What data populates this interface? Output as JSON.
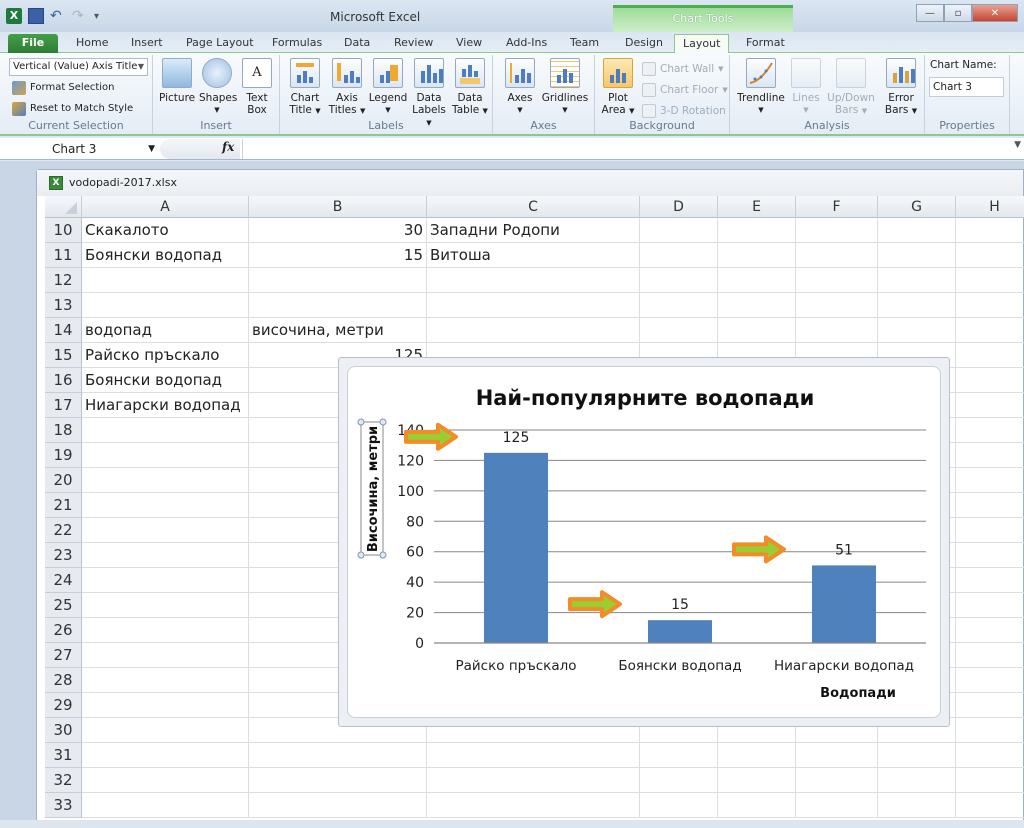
{
  "titlebar": {
    "app_title": "Microsoft Excel",
    "context_group": "Chart Tools",
    "qat": {
      "save": "save-icon",
      "undo": "undo-icon",
      "redo": "redo-icon"
    },
    "window_controls": {
      "minimize": "—",
      "maximize": "▫",
      "close": "✕"
    }
  },
  "tabs": [
    {
      "label": "File"
    },
    {
      "label": "Home"
    },
    {
      "label": "Insert"
    },
    {
      "label": "Page Layout"
    },
    {
      "label": "Formulas"
    },
    {
      "label": "Data"
    },
    {
      "label": "Review"
    },
    {
      "label": "View"
    },
    {
      "label": "Add-Ins"
    },
    {
      "label": "Team"
    },
    {
      "label": "Design"
    },
    {
      "label": "Layout",
      "active": true
    },
    {
      "label": "Format"
    }
  ],
  "ribbon": {
    "current_selection": {
      "dropdown_value": "Vertical (Value) Axis Title",
      "format_selection": "Format Selection",
      "reset": "Reset to Match Style",
      "group_label": "Current Selection"
    },
    "insert": {
      "picture": "Picture",
      "shapes": "Shapes",
      "text_box_1": "Text",
      "text_box_2": "Box",
      "group_label": "Insert"
    },
    "labels": {
      "chart_title_1": "Chart",
      "chart_title_2": "Title",
      "axis_titles_1": "Axis",
      "axis_titles_2": "Titles",
      "legend": "Legend",
      "data_labels_1": "Data",
      "data_labels_2": "Labels",
      "data_table_1": "Data",
      "data_table_2": "Table",
      "group_label": "Labels"
    },
    "axes": {
      "axes": "Axes",
      "gridlines": "Gridlines",
      "group_label": "Axes"
    },
    "background": {
      "plot_area_1": "Plot",
      "plot_area_2": "Area",
      "chart_wall": "Chart Wall",
      "chart_floor": "Chart Floor",
      "rotation": "3-D Rotation",
      "group_label": "Background"
    },
    "analysis": {
      "trendline": "Trendline",
      "lines": "Lines",
      "updown_1": "Up/Down",
      "updown_2": "Bars",
      "error_1": "Error",
      "error_2": "Bars",
      "group_label": "Analysis"
    },
    "properties": {
      "chart_name_label": "Chart Name:",
      "chart_name_value": "Chart 3",
      "group_label": "Properties"
    }
  },
  "formula_bar": {
    "name_box": "Chart 3",
    "fx": "fx",
    "formula": ""
  },
  "workbook": {
    "filename": "vodopadi-2017.xlsx",
    "columns": [
      "A",
      "B",
      "C",
      "D",
      "E",
      "F",
      "G",
      "H"
    ],
    "rows": [
      {
        "num": "10",
        "A": "Скакалото",
        "B": "30",
        "C": "Западни Родопи"
      },
      {
        "num": "11",
        "A": "Боянски водопад",
        "B": "15",
        "C": "Витоша"
      },
      {
        "num": "12",
        "A": "",
        "B": "",
        "C": ""
      },
      {
        "num": "13",
        "A": "",
        "B": "",
        "C": ""
      },
      {
        "num": "14",
        "A": "водопад",
        "B": "височина, метри",
        "C": ""
      },
      {
        "num": "15",
        "A": "Райско пръскало",
        "B": "125",
        "C": ""
      },
      {
        "num": "16",
        "A": "Боянски водопад",
        "B": "",
        "C": ""
      },
      {
        "num": "17",
        "A": "Ниагарски водопад",
        "B": "",
        "C": ""
      },
      {
        "num": "18",
        "A": "",
        "B": "",
        "C": ""
      },
      {
        "num": "19",
        "A": "",
        "B": "",
        "C": ""
      },
      {
        "num": "20",
        "A": "",
        "B": "",
        "C": ""
      },
      {
        "num": "21",
        "A": "",
        "B": "",
        "C": ""
      },
      {
        "num": "22",
        "A": "",
        "B": "",
        "C": ""
      },
      {
        "num": "23",
        "A": "",
        "B": "",
        "C": ""
      },
      {
        "num": "24",
        "A": "",
        "B": "",
        "C": ""
      },
      {
        "num": "25",
        "A": "",
        "B": "",
        "C": ""
      },
      {
        "num": "26",
        "A": "",
        "B": "",
        "C": ""
      },
      {
        "num": "27",
        "A": "",
        "B": "",
        "C": ""
      },
      {
        "num": "28",
        "A": "",
        "B": "",
        "C": ""
      },
      {
        "num": "29",
        "A": "",
        "B": "",
        "C": ""
      },
      {
        "num": "30",
        "A": "",
        "B": "",
        "C": ""
      },
      {
        "num": "31",
        "A": "",
        "B": "",
        "C": ""
      },
      {
        "num": "32",
        "A": "",
        "B": "",
        "C": ""
      },
      {
        "num": "33",
        "A": "",
        "B": "",
        "C": ""
      }
    ]
  },
  "colors": {
    "bar": "#4f81bd",
    "arrow_fill": "#9acd32",
    "arrow_stroke": "#f28c28",
    "gridline": "#868686",
    "file_tab": "#2e7d32"
  },
  "chart_data": {
    "type": "bar",
    "title": "Най-популярните водопади",
    "xlabel": "Водопади",
    "ylabel": "Височина,  метри",
    "categories": [
      "Райско пръскало",
      "Боянски водопад",
      "Ниагарски водопад"
    ],
    "values": [
      125,
      15,
      51
    ],
    "data_labels": [
      "125",
      "15",
      "51"
    ],
    "ylim": [
      0,
      140
    ],
    "yticks": [
      0,
      20,
      40,
      60,
      80,
      100,
      120,
      140
    ],
    "grid": true,
    "legend": "none",
    "annotations": [
      "arrow pointing to label 125",
      "arrow pointing to label 15",
      "arrow pointing to label 51"
    ]
  }
}
